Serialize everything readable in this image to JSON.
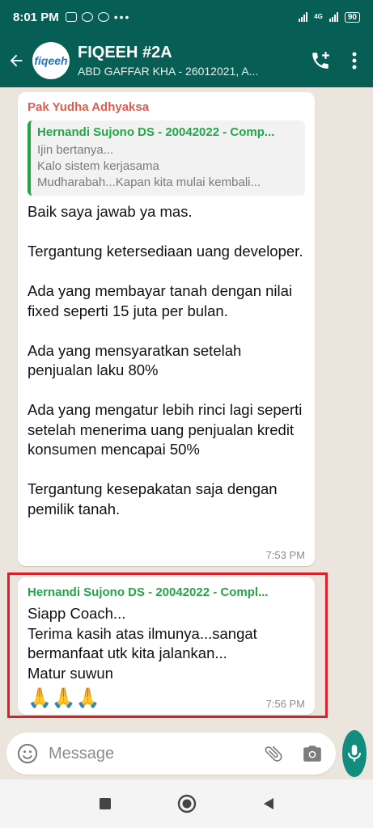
{
  "status_bar": {
    "time": "8:01 PM",
    "network": "4G",
    "battery": "90"
  },
  "header": {
    "title": "FIQEEH #2A",
    "subtitle": "ABD GAFFAR KHA - 26012021, A...",
    "avatar_text": "fiqeeh"
  },
  "messages": [
    {
      "sender": "Pak Yudha Adhyaksa",
      "quote": {
        "author": "Hernandi Sujono DS - 20042022 - Comp...",
        "text": "Ijin bertanya...\nKalo sistem kerjasama\nMudharabah...Kapan kita mulai kembali..."
      },
      "text": "Baik saya jawab ya mas.\n\nTergantung ketersediaan uang developer.\n\nAda yang membayar tanah dengan nilai fixed seperti 15 juta per bulan.\n\nAda yang mensyaratkan setelah penjualan laku 80%\n\nAda yang mengatur lebih rinci lagi seperti setelah menerima uang penjualan kredit konsumen mencapai 50%\n\nTergantung kesepakatan saja dengan pemilik tanah.",
      "time": "7:53 PM"
    },
    {
      "sender": "Hernandi Sujono DS - 20042022 - Compl...",
      "text": "Siapp Coach...\nTerima kasih atas ilmunya...sangat bermanfaat utk kita jalankan...\nMatur suwun",
      "emoji": "🙏🙏🙏",
      "time": "7:56 PM"
    }
  ],
  "input": {
    "placeholder": "Message"
  },
  "colors": {
    "header": "#075e54",
    "accent_green": "#25a244",
    "sender_red": "#e05b4e",
    "highlight_red": "#d9212b",
    "mic_button": "#128c7e"
  }
}
